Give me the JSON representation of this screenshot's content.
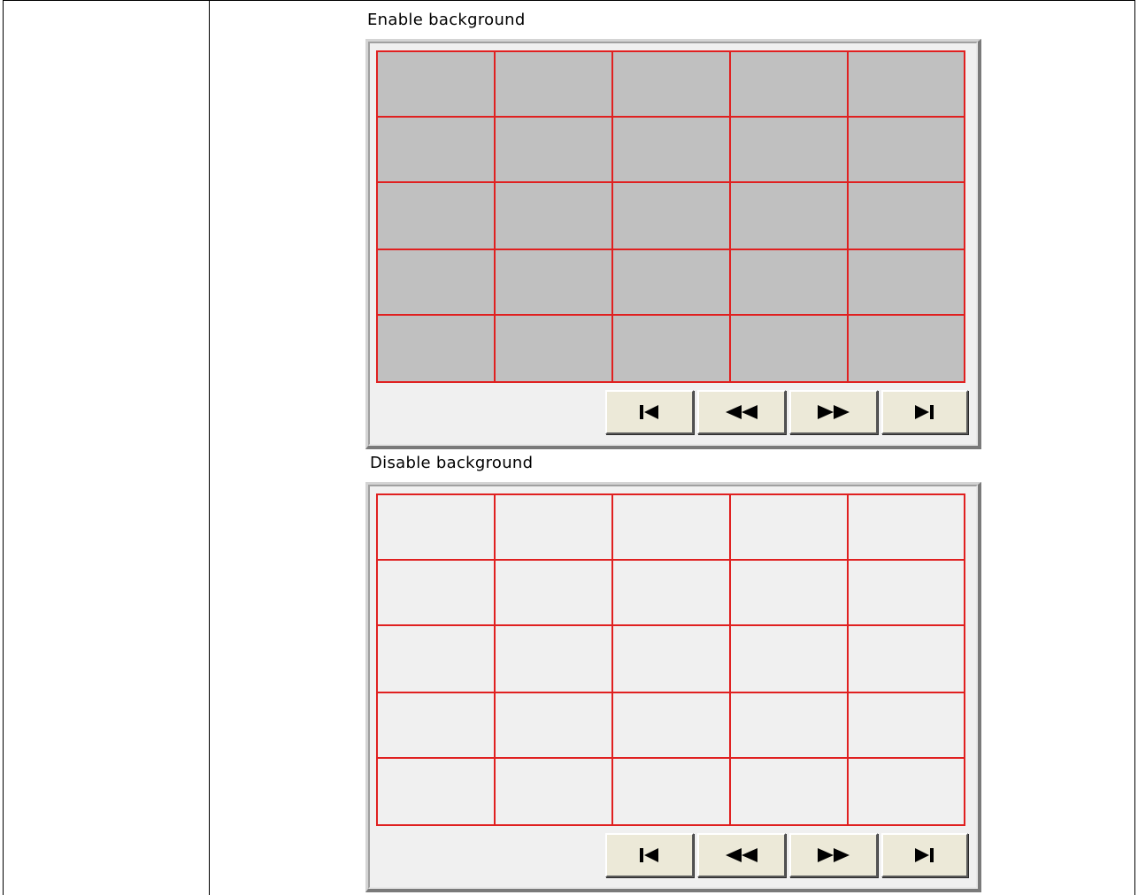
{
  "panels": [
    {
      "caption": "Enable background",
      "cell_color": "#c0c0c0",
      "grid_line_color": "#e02020",
      "rows": 5,
      "cols": 5
    },
    {
      "caption": "Disable background",
      "cell_color": "#f0f0f0",
      "grid_line_color": "#e02020",
      "rows": 5,
      "cols": 5
    }
  ],
  "nav_buttons": [
    {
      "name": "first-page-button",
      "icon": "skip-to-first-icon"
    },
    {
      "name": "previous-page-button",
      "icon": "rewind-icon"
    },
    {
      "name": "next-page-button",
      "icon": "fast-forward-icon"
    },
    {
      "name": "last-page-button",
      "icon": "skip-to-last-icon"
    }
  ]
}
